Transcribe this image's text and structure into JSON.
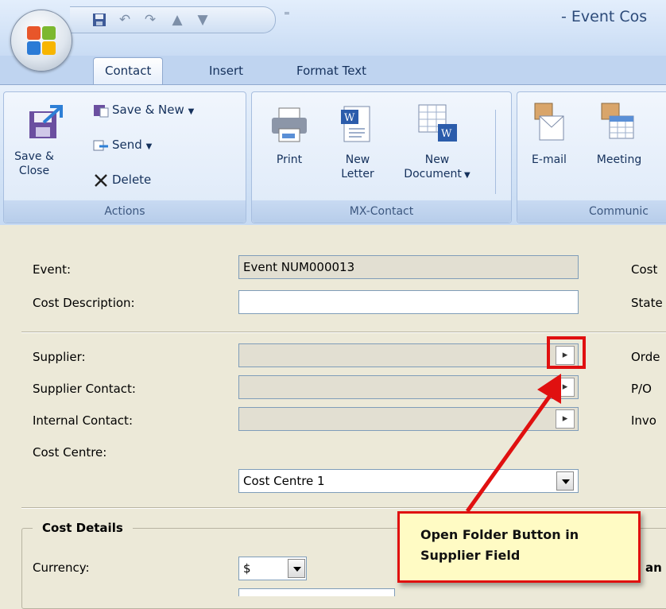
{
  "window": {
    "title": "- Event Cos"
  },
  "colors": {
    "accent_red": "#e01010",
    "callout_bg": "#fffbc4",
    "ribbon_blue": "#c6daf3"
  },
  "qat": {
    "icons": [
      "save-icon",
      "undo-icon",
      "redo-icon",
      "up-arrow-icon",
      "down-arrow-icon"
    ],
    "customize": "⁼"
  },
  "tabs": [
    {
      "label": "Contact"
    },
    {
      "label": "Insert"
    },
    {
      "label": "Format Text"
    }
  ],
  "ribbon": {
    "actions": {
      "label": "Actions",
      "save_close": "Save &",
      "save_close_2": "Close",
      "save_new": "Save & New",
      "send": "Send",
      "delete": "Delete"
    },
    "mx_contact": {
      "label": "MX-Contact",
      "print": "Print",
      "new_letter_1": "New",
      "new_letter_2": "Letter",
      "new_document_1": "New",
      "new_document_2": "Document"
    },
    "communicate": {
      "label": "Communic",
      "email": "E-mail",
      "meeting": "Meeting"
    }
  },
  "form": {
    "event_label": "Event:",
    "event_value": "Event NUM000013",
    "cost_description_label": "Cost Description:",
    "cost_description_value": "",
    "supplier_label": "Supplier:",
    "supplier_contact_label": "Supplier Contact:",
    "internal_contact_label": "Internal Contact:",
    "cost_centre_label": "Cost Centre:",
    "cost_centre_value": "Cost Centre 1",
    "right_labels": {
      "cost": "Cost",
      "state": "State",
      "order": "Orde",
      "po": "P/O",
      "invoice": "Invo"
    },
    "cost_details": {
      "legend": "Cost Details",
      "currency_label": "Currency:",
      "currency_value": "$",
      "partial_right": "an"
    }
  },
  "callout": {
    "line1": "Open Folder Button in",
    "line2": "Supplier Field"
  }
}
